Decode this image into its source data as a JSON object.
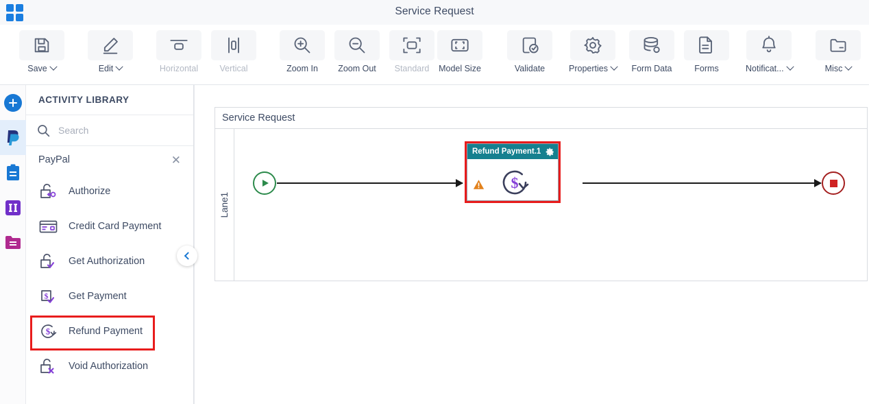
{
  "titlebar": {
    "app_grid_icon": "app-grid-icon",
    "title": "Service Request"
  },
  "toolbar": {
    "items": [
      {
        "label": "Save",
        "icon": "save-icon",
        "caret": true,
        "disabled": false
      },
      {
        "label": "Edit",
        "icon": "edit-pencil-icon",
        "caret": true,
        "disabled": false
      },
      {
        "label": "Horizontal",
        "icon": "horizontal-layout-icon",
        "caret": false,
        "disabled": true
      },
      {
        "label": "Vertical",
        "icon": "vertical-layout-icon",
        "caret": false,
        "disabled": true
      },
      {
        "label": "Zoom In",
        "icon": "zoom-in-icon",
        "caret": false,
        "disabled": false
      },
      {
        "label": "Zoom Out",
        "icon": "zoom-out-icon",
        "caret": false,
        "disabled": false
      },
      {
        "label": "Standard",
        "icon": "standard-size-icon",
        "caret": false,
        "disabled": true
      },
      {
        "label": "Model Size",
        "icon": "model-size-icon",
        "caret": false,
        "disabled": false
      },
      {
        "label": "Validate",
        "icon": "validate-icon",
        "caret": false,
        "disabled": false
      },
      {
        "label": "Properties",
        "icon": "gear-icon",
        "caret": true,
        "disabled": false
      },
      {
        "label": "Form Data",
        "icon": "database-icon",
        "caret": false,
        "disabled": false
      },
      {
        "label": "Forms",
        "icon": "forms-icon",
        "caret": false,
        "disabled": false
      },
      {
        "label": "Notificat...",
        "icon": "bell-icon",
        "caret": true,
        "disabled": false
      },
      {
        "label": "Misc",
        "icon": "folder-misc-icon",
        "caret": true,
        "disabled": false
      }
    ]
  },
  "rail": {
    "items": [
      {
        "name": "add-button",
        "icon": "plus-circle-icon",
        "selected": false
      },
      {
        "name": "paypal-connector",
        "icon": "paypal-icon",
        "selected": true
      },
      {
        "name": "clipboard-library",
        "icon": "clipboard-icon",
        "selected": false
      },
      {
        "name": "columns-library",
        "icon": "columns-icon",
        "selected": false
      },
      {
        "name": "folder-library",
        "icon": "folder-icon",
        "selected": false
      }
    ]
  },
  "panel": {
    "heading": "ACTIVITY LIBRARY",
    "search": {
      "value": "",
      "placeholder": "Search",
      "icon": "search-icon"
    },
    "group": {
      "label": "PayPal",
      "close_icon": "close-icon"
    },
    "items": [
      {
        "label": "Authorize",
        "icon": "unlock-key-icon",
        "highlight": false
      },
      {
        "label": "Credit Card Payment",
        "icon": "credit-card-icon",
        "highlight": false
      },
      {
        "label": "Get Authorization",
        "icon": "unlock-check-icon",
        "highlight": false
      },
      {
        "label": "Get Payment",
        "icon": "dollar-check-icon",
        "highlight": false
      },
      {
        "label": "Refund Payment",
        "icon": "refund-dollar-icon",
        "highlight": true
      },
      {
        "label": "Void Authorization",
        "icon": "unlock-x-icon",
        "highlight": false
      }
    ],
    "collapse_icon": "chevron-left-icon"
  },
  "canvas": {
    "pool_title": "Service Request",
    "lane_label": "Lane1",
    "start_event": {
      "name": "start-event",
      "icon": "play-icon"
    },
    "end_event": {
      "name": "end-event",
      "icon": "stop-square-icon"
    },
    "task": {
      "title": "Refund Payment.1",
      "gear_icon": "gear-icon",
      "warning_icon": "warning-triangle-icon",
      "body_icon": "refund-dollar-icon"
    }
  },
  "colors": {
    "accent_blue": "#1878d4",
    "task_header_teal": "#15808f",
    "selection_red": "#e81c1c",
    "start_green": "#2c8a4b",
    "end_red": "#a42020",
    "warning_orange": "#e2811c",
    "icon_purple": "#8540d8"
  }
}
